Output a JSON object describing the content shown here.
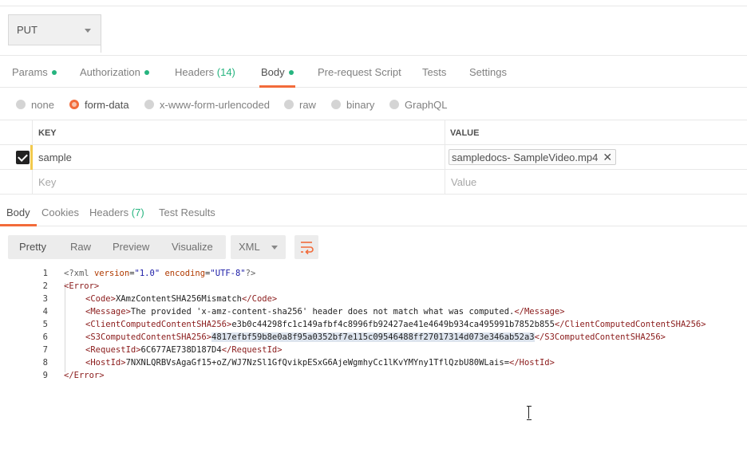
{
  "request": {
    "method": "PUT"
  },
  "request_tabs": [
    {
      "label": "Params",
      "dot": true
    },
    {
      "label": "Authorization",
      "dot": true
    },
    {
      "label": "Headers",
      "count": "(14)"
    },
    {
      "label": "Body",
      "dot": true,
      "active": true
    },
    {
      "label": "Pre-request Script"
    },
    {
      "label": "Tests"
    },
    {
      "label": "Settings"
    }
  ],
  "body_types": [
    {
      "label": "none"
    },
    {
      "label": "form-data",
      "selected": true
    },
    {
      "label": "x-www-form-urlencoded"
    },
    {
      "label": "raw"
    },
    {
      "label": "binary"
    },
    {
      "label": "GraphQL"
    }
  ],
  "form": {
    "key_header": "KEY",
    "value_header": "VALUE",
    "rows": [
      {
        "checked": true,
        "key": "sample",
        "value_file": "sampledocs- SampleVideo.mp4"
      }
    ],
    "key_placeholder": "Key",
    "value_placeholder": "Value"
  },
  "response_tabs": [
    {
      "label": "Body",
      "active": true
    },
    {
      "label": "Cookies"
    },
    {
      "label": "Headers",
      "count": "(7)"
    },
    {
      "label": "Test Results"
    }
  ],
  "response_toolbar": {
    "formats": [
      "Pretty",
      "Raw",
      "Preview",
      "Visualize"
    ],
    "active_format": "Pretty",
    "language": "XML"
  },
  "response_lines": [
    "1",
    "2",
    "3",
    "4",
    "5",
    "6",
    "7",
    "8",
    "9"
  ],
  "xml": {
    "decl_version": "\"1.0\"",
    "decl_encoding": "\"UTF-8\"",
    "code": "XAmzContentSHA256Mismatch",
    "message": "The provided 'x-amz-content-sha256' header does not match what was computed.",
    "client_sha": "e3b0c44298fc1c149afbf4c8996fb92427ae41e4649b934ca495991b7852b855",
    "s3_sha": "4817efbf59b8e0a8f95a0352bf7e115c09546488ff27017314d073e346ab52a3",
    "request_id": "6C677AE738D187D4",
    "host_id": "7NXNLQRBVsAgaGf15+oZ/WJ7NzSl1GfQvikpESxG6AjeWgmhyCc1lKvYMYny1TflQzbU80WLais="
  }
}
